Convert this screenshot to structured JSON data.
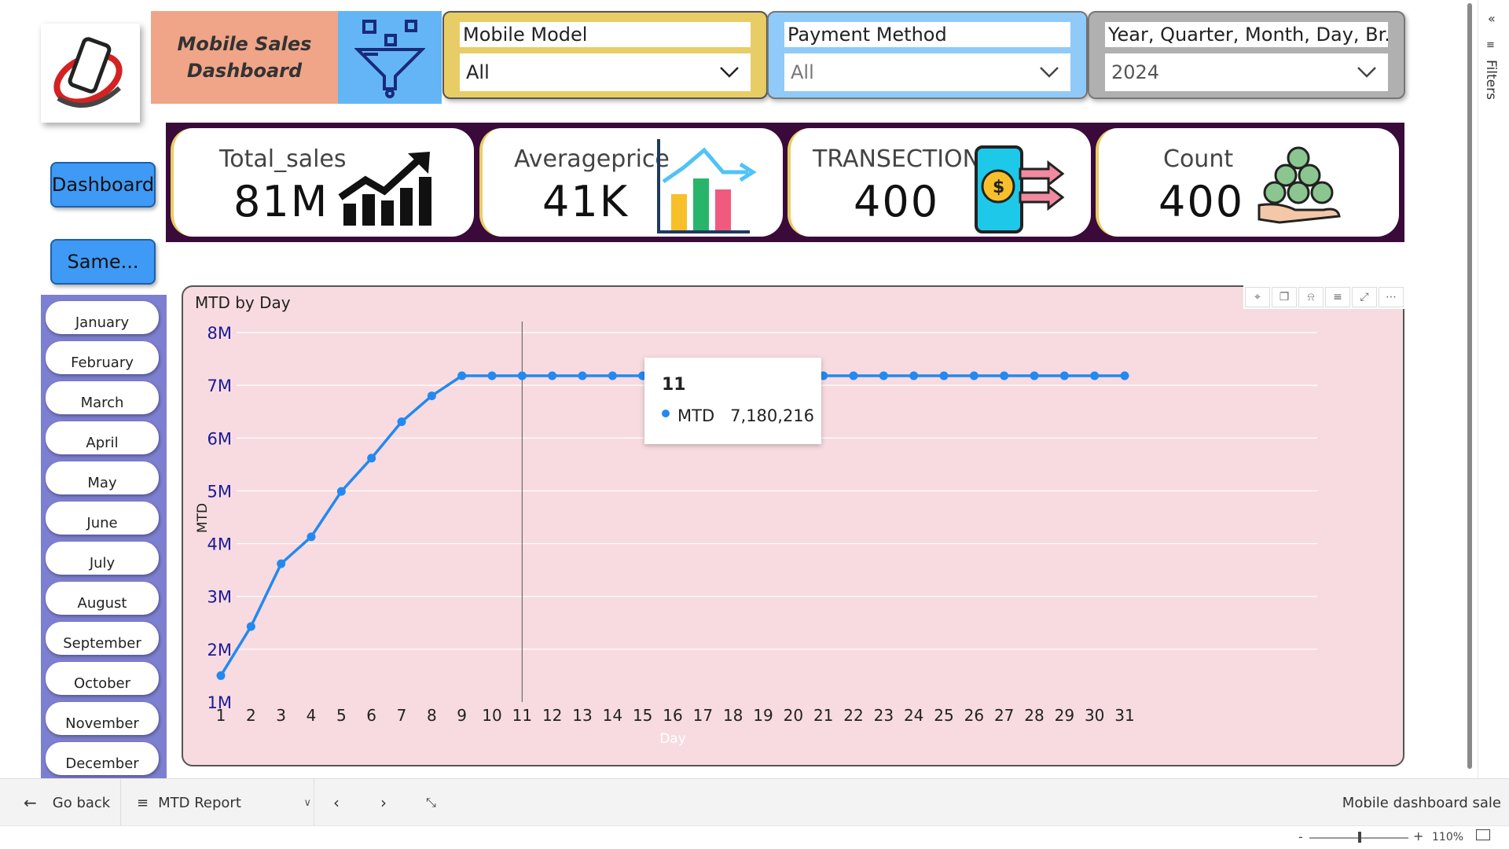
{
  "header": {
    "title": "Mobile Sales\nDashboard"
  },
  "slicers": [
    {
      "label": "Mobile Model",
      "value": "All"
    },
    {
      "label": "Payment Method",
      "value": "All"
    },
    {
      "label": "Year, Quarter, Month, Day, Br...",
      "value": "2024"
    }
  ],
  "nav": {
    "dashboard_label": "Dashboard",
    "same_label": "Same..."
  },
  "months": [
    "January",
    "February",
    "March",
    "April",
    "May",
    "June",
    "July",
    "August",
    "September",
    "October",
    "November",
    "December"
  ],
  "kpis": [
    {
      "label": "Total_sales",
      "value": "81M",
      "icon": "trend-up-bars-icon"
    },
    {
      "label": "Averageprice",
      "value": "41K",
      "icon": "bar-chart-icon"
    },
    {
      "label": "TRANSECTION",
      "value": "400",
      "icon": "phone-payment-icon"
    },
    {
      "label": "Count",
      "value": "400",
      "icon": "money-bags-hand-icon"
    }
  ],
  "chart": {
    "title": "MTD by Day",
    "toolbar": [
      "pin-icon",
      "copy-icon",
      "bell-icon",
      "filter-icon",
      "expand-icon",
      "more-icon"
    ],
    "tooltip": {
      "day": "11",
      "series": "MTD",
      "value": "7,180,216"
    }
  },
  "chart_data": {
    "type": "line",
    "title": "MTD by Day",
    "xlabel": "Day",
    "ylabel": "MTD",
    "ylim": [
      1000000,
      8000000
    ],
    "yticks": [
      "1M",
      "2M",
      "3M",
      "4M",
      "5M",
      "6M",
      "7M",
      "8M"
    ],
    "x": [
      1,
      2,
      3,
      4,
      5,
      6,
      7,
      8,
      9,
      10,
      11,
      12,
      13,
      14,
      15,
      16,
      17,
      18,
      19,
      20,
      21,
      22,
      23,
      24,
      25,
      26,
      27,
      28,
      29,
      30,
      31
    ],
    "series": [
      {
        "name": "MTD",
        "values": [
          1500000,
          2430000,
          3620000,
          4130000,
          4990000,
          5620000,
          6310000,
          6800000,
          7180216,
          7180216,
          7180216,
          7180216,
          7180216,
          7180216,
          7180216,
          7180216,
          7180216,
          7180216,
          7180216,
          7180216,
          7180216,
          7180216,
          7180216,
          7180216,
          7180216,
          7180216,
          7180216,
          7180216,
          7180216,
          7180216,
          7180216
        ]
      }
    ],
    "grid": true,
    "colors": {
      "line": "#2389f0",
      "axis_text": "#1a1a9a",
      "background": "#f7dbe0"
    }
  },
  "bottom": {
    "go_back": "Go back",
    "page_name": "MTD Report",
    "report_name": "Mobile dashboard sale",
    "zoom": "110%"
  },
  "filters_pane": {
    "label": "Filters"
  }
}
